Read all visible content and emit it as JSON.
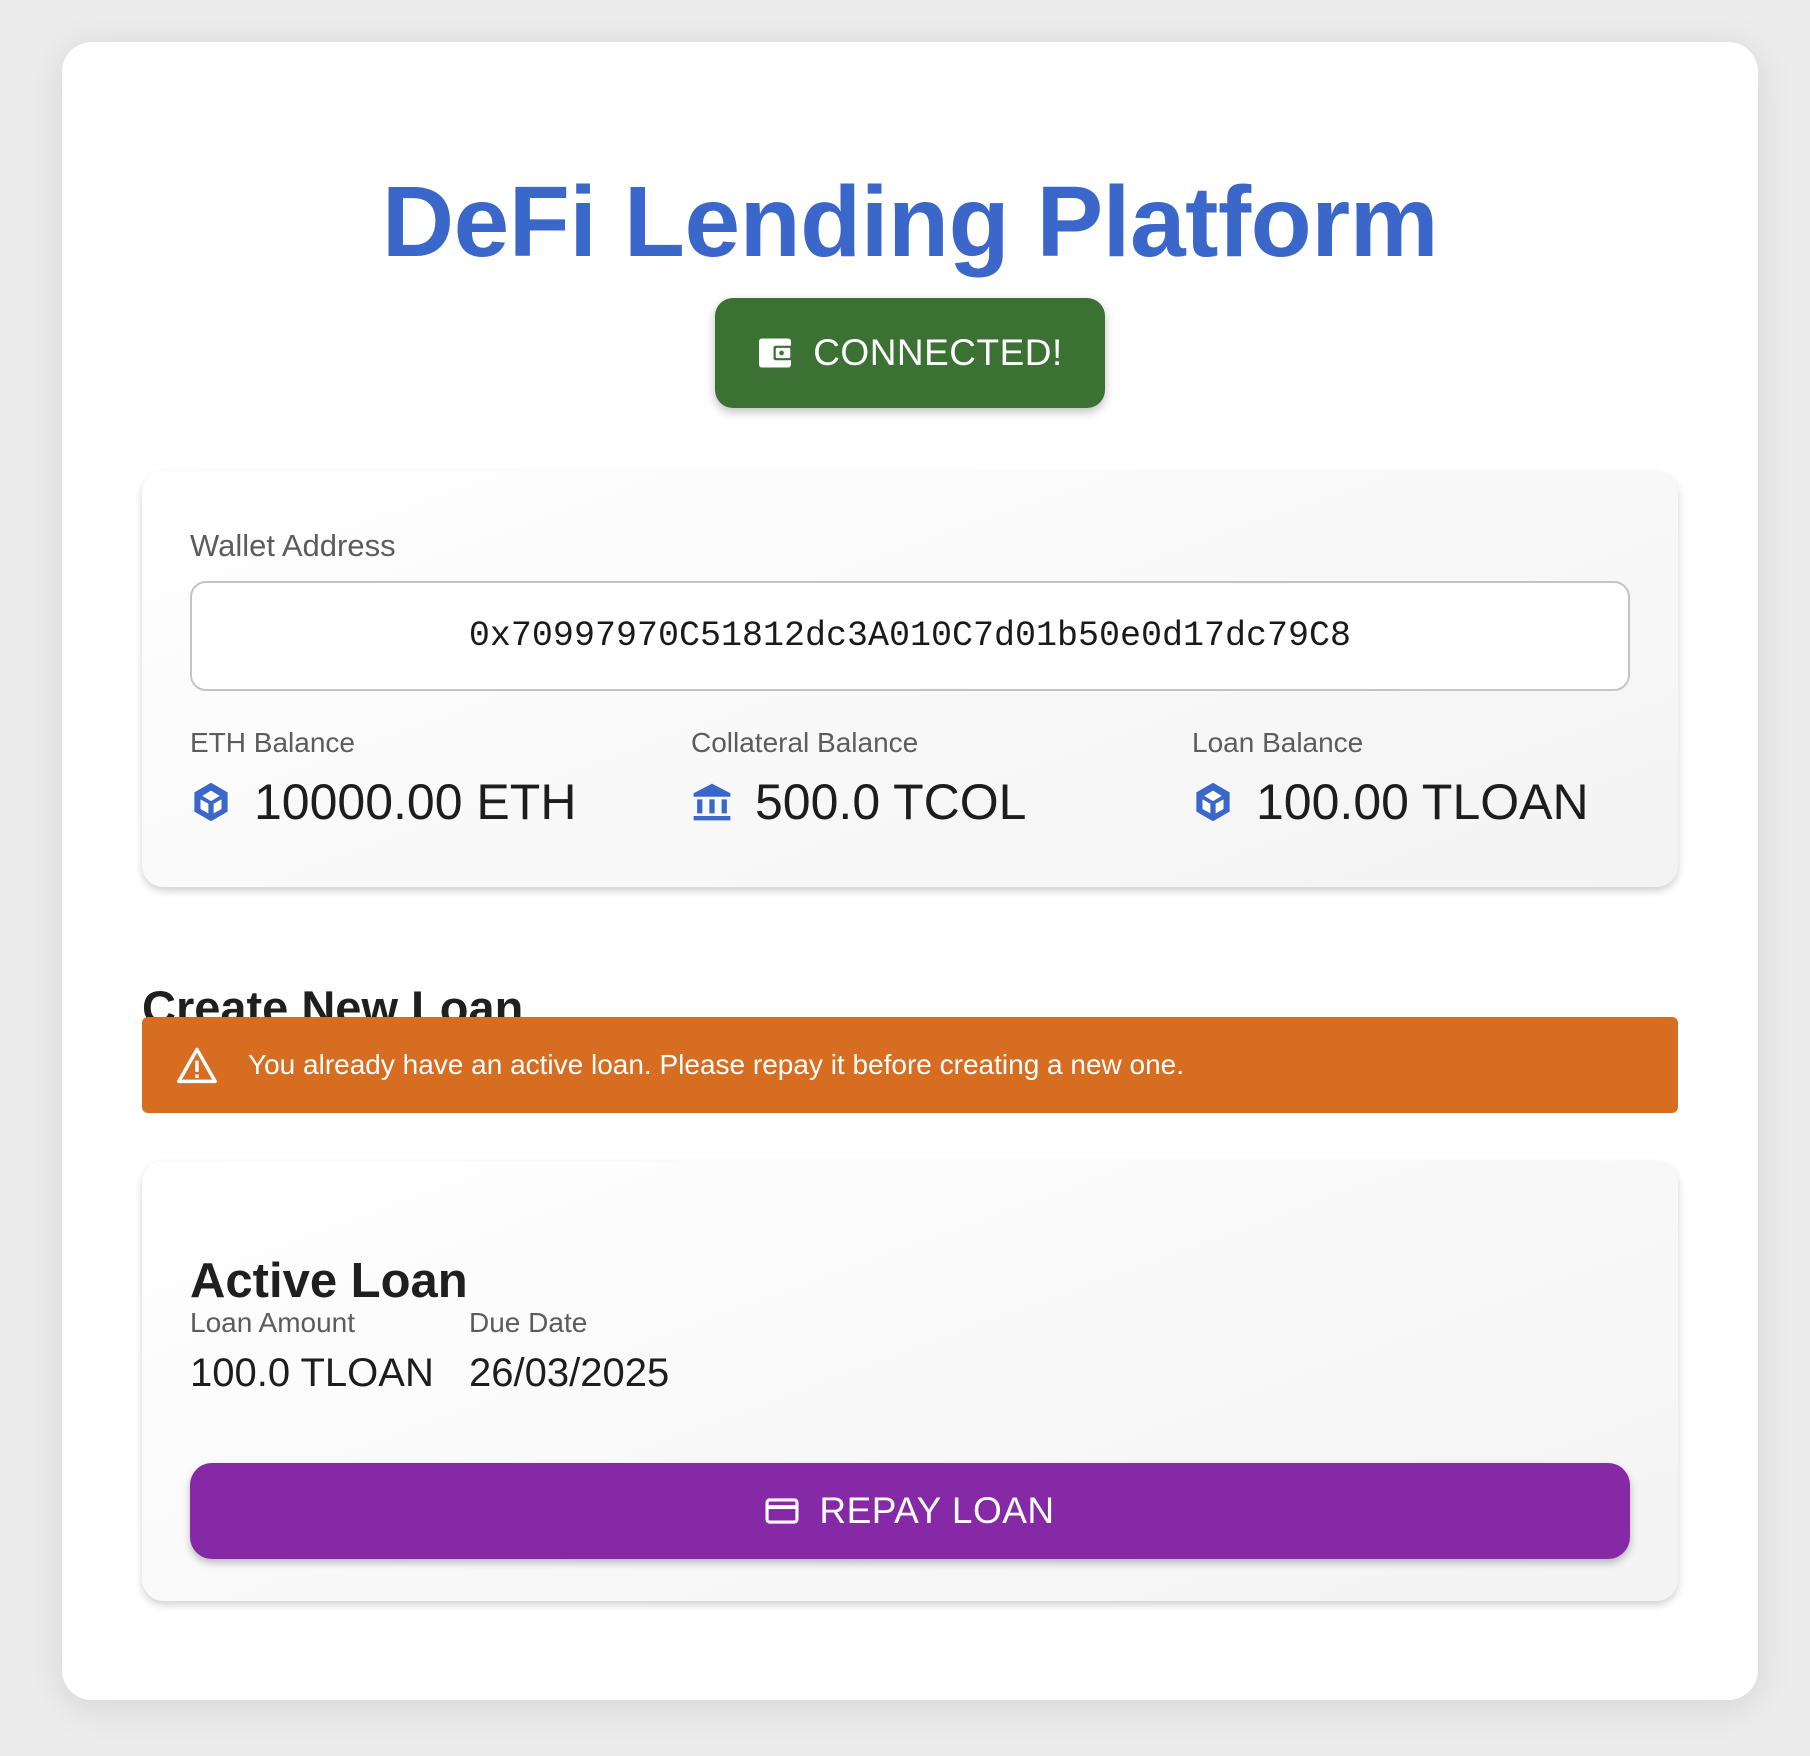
{
  "header": {
    "title": "DeFi Lending Platform"
  },
  "connect_button": {
    "label": "CONNECTED!",
    "icon": "wallet-icon",
    "color": "#3b7132"
  },
  "wallet": {
    "address_label": "Wallet Address",
    "address": "0x70997970C51812dc3A010C7d01b50e0d17dc79C8",
    "balances": [
      {
        "label": "ETH Balance",
        "value": "10000.00 ETH",
        "icon": "token-icon"
      },
      {
        "label": "Collateral Balance",
        "value": "500.0 TCOL",
        "icon": "bank-icon"
      },
      {
        "label": "Loan Balance",
        "value": "100.00 TLOAN",
        "icon": "token-icon"
      }
    ]
  },
  "create_loan": {
    "title": "Create New Loan",
    "warning": "You already have an active loan. Please repay it before creating a new one.",
    "warning_icon": "warning-icon",
    "warning_color": "#d76d21"
  },
  "active_loan": {
    "title": "Active Loan",
    "amount_label": "Loan Amount",
    "amount": "100.0 TLOAN",
    "due_label": "Due Date",
    "due": "26/03/2025",
    "repay_label": "REPAY LOAN",
    "repay_icon": "credit-card-icon",
    "repay_color": "#8629a6"
  },
  "colors": {
    "title": "#3a67c9",
    "icon_blue": "#3a67c9"
  }
}
